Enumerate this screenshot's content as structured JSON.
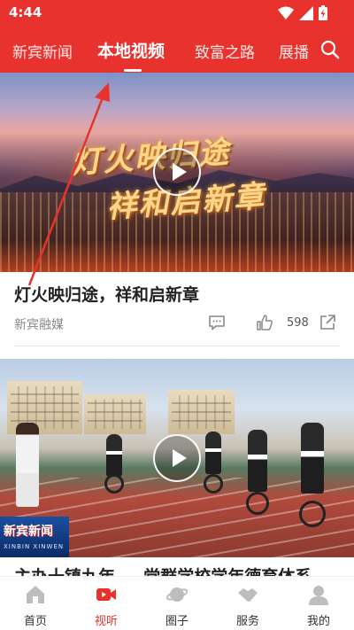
{
  "status_bar": {
    "time": "4:44"
  },
  "tabs": [
    {
      "label": "新宾新闻"
    },
    {
      "label": "本地视频"
    },
    {
      "label": "致富之路"
    },
    {
      "label": "展播"
    }
  ],
  "cards": [
    {
      "overlay_line1": "灯火映归途",
      "overlay_line2": "祥和启新章",
      "title": "灯火映归途，祥和启新章",
      "source": "新宾融媒",
      "likes": "598"
    },
    {
      "logo_main": "新宾新闻",
      "logo_sub": "XINBIN XINWEN",
      "title_partial": "主办十镇九年 — 党群学校学年德育体系"
    }
  ],
  "bottom_nav": [
    {
      "label": "首页",
      "icon": "home-icon"
    },
    {
      "label": "视听",
      "icon": "video-icon"
    },
    {
      "label": "圈子",
      "icon": "planet-icon"
    },
    {
      "label": "服务",
      "icon": "handshake-icon"
    },
    {
      "label": "我的",
      "icon": "user-icon"
    }
  ],
  "colors": {
    "brand": "#e8322e",
    "annotation": "#e8322e"
  }
}
